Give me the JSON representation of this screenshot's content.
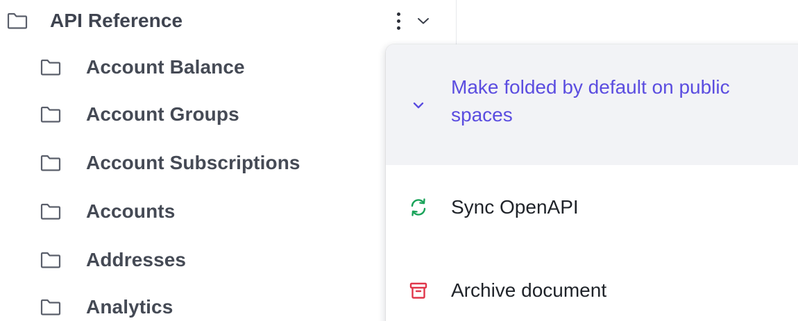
{
  "tree": {
    "root": {
      "label": "API Reference",
      "icon": "folder-icon"
    },
    "children": [
      {
        "label": "Account Balance",
        "icon": "folder-icon"
      },
      {
        "label": "Account Groups",
        "icon": "folder-icon"
      },
      {
        "label": "Account Subscriptions",
        "icon": "folder-icon"
      },
      {
        "label": "Accounts",
        "icon": "folder-icon"
      },
      {
        "label": "Addresses",
        "icon": "folder-icon"
      },
      {
        "label": "Analytics",
        "icon": "folder-icon"
      }
    ]
  },
  "actions": {
    "more_icon": "kebab-icon",
    "expand_icon": "chevron-down-icon"
  },
  "menu": {
    "items": [
      {
        "label": "Make folded by default on public spaces",
        "icon": "chevron-down-icon",
        "color": "#5b4de0"
      },
      {
        "label": "Sync OpenAPI",
        "icon": "sync-icon",
        "color": "#1aa35a"
      },
      {
        "label": "Archive document",
        "icon": "archive-icon",
        "color": "#e0364a"
      }
    ]
  },
  "colors": {
    "accent": "#5b4de0",
    "highlight_bg": "#f2f3f6",
    "tree_text": "#454a55"
  }
}
